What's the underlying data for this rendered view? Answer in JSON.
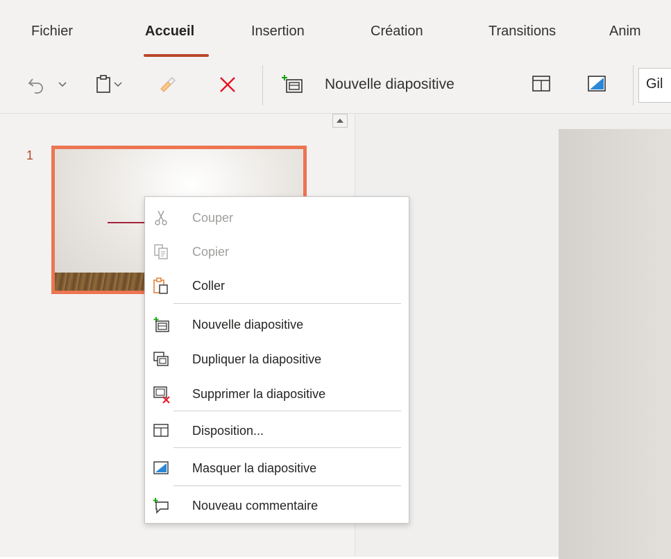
{
  "ribbon": {
    "tabs": [
      {
        "label": "Fichier"
      },
      {
        "label": "Accueil"
      },
      {
        "label": "Insertion"
      },
      {
        "label": "Création"
      },
      {
        "label": "Transitions"
      },
      {
        "label": "Anim"
      }
    ],
    "active_tab": "Accueil"
  },
  "toolbar": {
    "new_slide_label": "Nouvelle diapositive",
    "font_name": "Gil",
    "icons": [
      "undo-icon",
      "chevron-down-icon",
      "paste-icon",
      "format-painter-icon",
      "delete-icon",
      "new-slide-icon",
      "layout-icon",
      "hide-slide-icon"
    ]
  },
  "thumbnails": {
    "slide_number": "1"
  },
  "context_menu": {
    "items": [
      {
        "label": "Couper",
        "icon": "scissors-icon",
        "enabled": false
      },
      {
        "label": "Copier",
        "icon": "copy-icon",
        "enabled": false
      },
      {
        "label": "Coller",
        "icon": "paste-icon",
        "enabled": true
      },
      {
        "label": "Nouvelle diapositive",
        "icon": "new-slide-icon",
        "enabled": true
      },
      {
        "label": "Dupliquer la diapositive",
        "icon": "duplicate-slide-icon",
        "enabled": true
      },
      {
        "label": "Supprimer la diapositive",
        "icon": "delete-slide-icon",
        "enabled": true
      },
      {
        "label": "Disposition...",
        "icon": "layout-icon",
        "enabled": true
      },
      {
        "label": "Masquer la diapositive",
        "icon": "hide-slide-icon",
        "enabled": true
      },
      {
        "label": "Nouveau commentaire",
        "icon": "comment-icon",
        "enabled": true
      }
    ]
  },
  "colors": {
    "accent": "#b7472a",
    "selection_border": "#ed7552",
    "green_plus": "#13a10e",
    "red_x": "#e81123",
    "blue_fill": "#2b88d8"
  }
}
